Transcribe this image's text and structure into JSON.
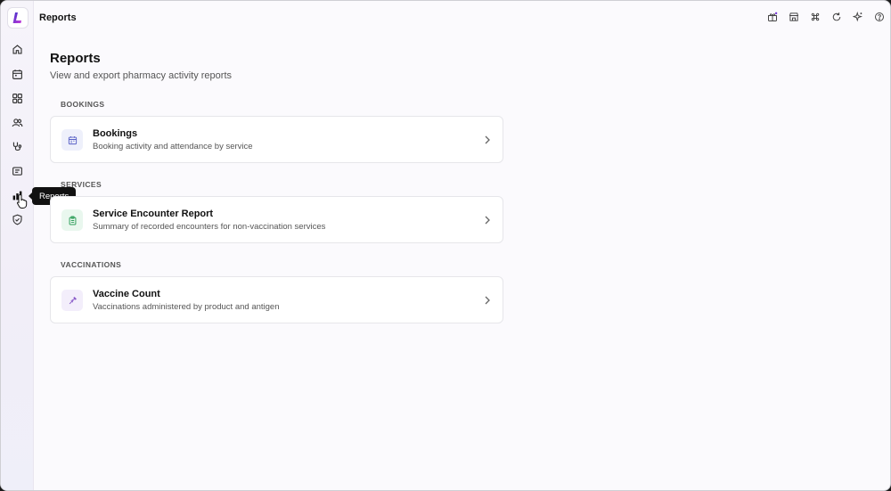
{
  "header": {
    "title": "Reports"
  },
  "sidebar": {
    "items": [
      {
        "name": "home-icon"
      },
      {
        "name": "calendar-icon"
      },
      {
        "name": "grid-icon"
      },
      {
        "name": "users-icon"
      },
      {
        "name": "stethoscope-icon"
      },
      {
        "name": "message-icon"
      },
      {
        "name": "bar-chart-icon"
      },
      {
        "name": "shield-icon"
      }
    ],
    "tooltip": "Reports"
  },
  "top_actions": [
    "gift-icon",
    "store-icon",
    "command-icon",
    "refresh-icon",
    "sparkle-icon",
    "help-icon"
  ],
  "main": {
    "title": "Reports",
    "subtitle": "View and export pharmacy activity reports",
    "sections": [
      {
        "label": "BOOKINGS",
        "card": {
          "title": "Bookings",
          "description": "Booking activity and attendance by service",
          "icon": "calendar-icon",
          "icon_bg": "#eef0fb",
          "icon_color": "#5b63c7"
        }
      },
      {
        "label": "SERVICES",
        "card": {
          "title": "Service Encounter Report",
          "description": "Summary of recorded encounters for non-vaccination services",
          "icon": "clipboard-icon",
          "icon_bg": "#e9f7ee",
          "icon_color": "#2f9e5a"
        }
      },
      {
        "label": "VACCINATIONS",
        "card": {
          "title": "Vaccine Count",
          "description": "Vaccinations administered by product and antigen",
          "icon": "syringe-icon",
          "icon_bg": "#f3eefb",
          "icon_color": "#8a5cc9"
        }
      }
    ]
  }
}
